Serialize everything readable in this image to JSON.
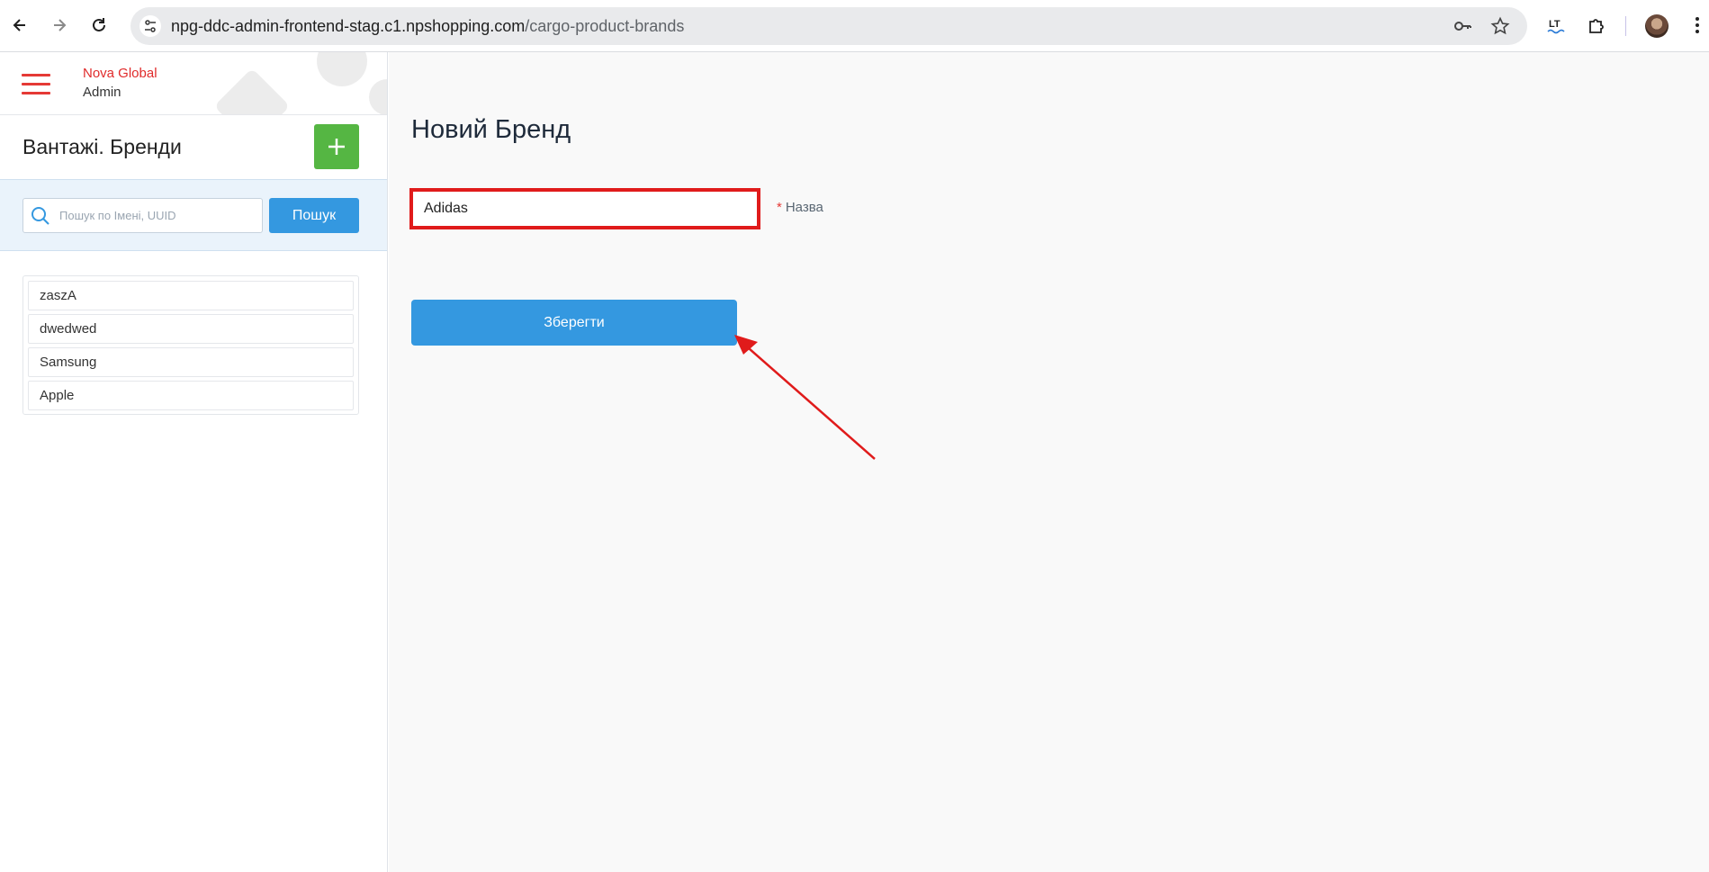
{
  "browser": {
    "url_host": "npg-ddc-admin-frontend-stag.c1.npshopping.com",
    "url_path": "/cargo-product-brands"
  },
  "sidebar": {
    "brand_line1": "Nova Global",
    "brand_line2": "Admin",
    "section_title": "Вантажі. Бренди",
    "search": {
      "placeholder": "Пошук по Імені, UUID",
      "value": "",
      "button_label": "Пошук"
    },
    "items": [
      {
        "label": "zaszA"
      },
      {
        "label": "dwedwed"
      },
      {
        "label": "Samsung"
      },
      {
        "label": "Apple"
      }
    ]
  },
  "main": {
    "title": "Новий Бренд",
    "name_field": {
      "value": "Adidas",
      "required_mark": "*",
      "label": "Назва"
    },
    "save_label": "Зберегти"
  },
  "colors": {
    "brand_red": "#e02b2b",
    "primary_blue": "#3498e0",
    "add_green": "#55b643",
    "highlight_red": "#e01b1b"
  },
  "icons": {
    "back": "arrow-left-icon",
    "forward": "arrow-right-icon",
    "reload": "reload-icon",
    "site_info": "tune-icon",
    "password": "key-icon",
    "bookmark": "star-icon",
    "languagetool": "languagetool-icon",
    "extensions": "puzzle-icon",
    "menu": "kebab-menu-icon",
    "hamburger": "hamburger-icon",
    "add": "plus-icon",
    "search": "search-icon",
    "annotation": "red-arrow-annotation"
  }
}
